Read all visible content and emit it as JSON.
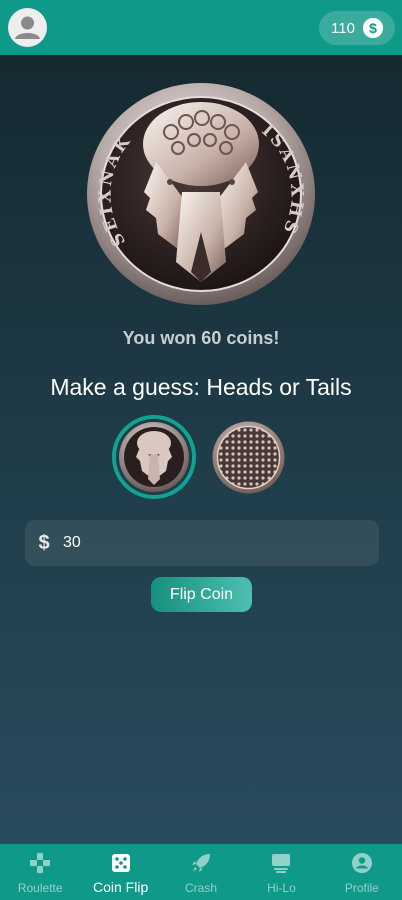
{
  "header": {
    "balance": "110",
    "icons": {
      "avatar": "person-icon",
      "currency": "dollar-coin-icon"
    }
  },
  "game": {
    "result_message": "You won 60 coins!",
    "prompt": "Make a guess: Heads or Tails",
    "selected_choice": "heads",
    "choices": [
      {
        "id": "heads",
        "icon": "heads-coin-icon"
      },
      {
        "id": "tails",
        "icon": "tails-coin-icon"
      }
    ],
    "coin_text_left": "SEIXNAK",
    "coin_text_right": "ISANXHS"
  },
  "bet": {
    "currency_symbol": "$",
    "value": "30"
  },
  "flip_button": {
    "label": "Flip Coin"
  },
  "nav": {
    "items": [
      {
        "label": "Roulette",
        "icon": "gamepad-icon",
        "active": false
      },
      {
        "label": "Coin Flip",
        "icon": "dice-icon",
        "active": true
      },
      {
        "label": "Crash",
        "icon": "rocket-icon",
        "active": false
      },
      {
        "label": "Hi-Lo",
        "icon": "card-icon",
        "active": false
      },
      {
        "label": "Profile",
        "icon": "profile-icon",
        "active": false
      }
    ]
  },
  "colors": {
    "accent": "#0f9988",
    "background_top": "#14272d",
    "background_bottom": "#2a4e60"
  }
}
